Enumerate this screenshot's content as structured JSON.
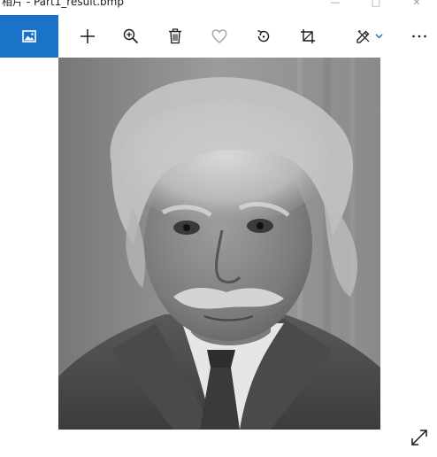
{
  "window": {
    "title": "相片 - Part1_result.bmp",
    "controls": [
      {
        "name": "minimize",
        "glyph": "—"
      },
      {
        "name": "maximize",
        "glyph": "□"
      },
      {
        "name": "close",
        "glyph": "✕"
      }
    ]
  },
  "toolbar": {
    "accent": "#1a73c8",
    "items": [
      {
        "name": "view-photo",
        "icon": "image-icon",
        "active": true
      },
      {
        "name": "add",
        "icon": "plus-icon"
      },
      {
        "name": "zoom",
        "icon": "zoom-in-icon"
      },
      {
        "name": "delete",
        "icon": "trash-icon"
      },
      {
        "name": "favorite",
        "icon": "heart-icon"
      },
      {
        "name": "rotate",
        "icon": "rotate-icon"
      },
      {
        "name": "crop",
        "icon": "crop-icon"
      },
      {
        "name": "edit",
        "icon": "edit-icon",
        "dropdown": true
      },
      {
        "name": "more",
        "icon": "more-icon"
      }
    ]
  },
  "photo": {
    "subject": "Grayscale portrait photograph of an elderly man with wild white hair and a mustache"
  },
  "viewer": {
    "expand_icon": "expand-icon"
  }
}
